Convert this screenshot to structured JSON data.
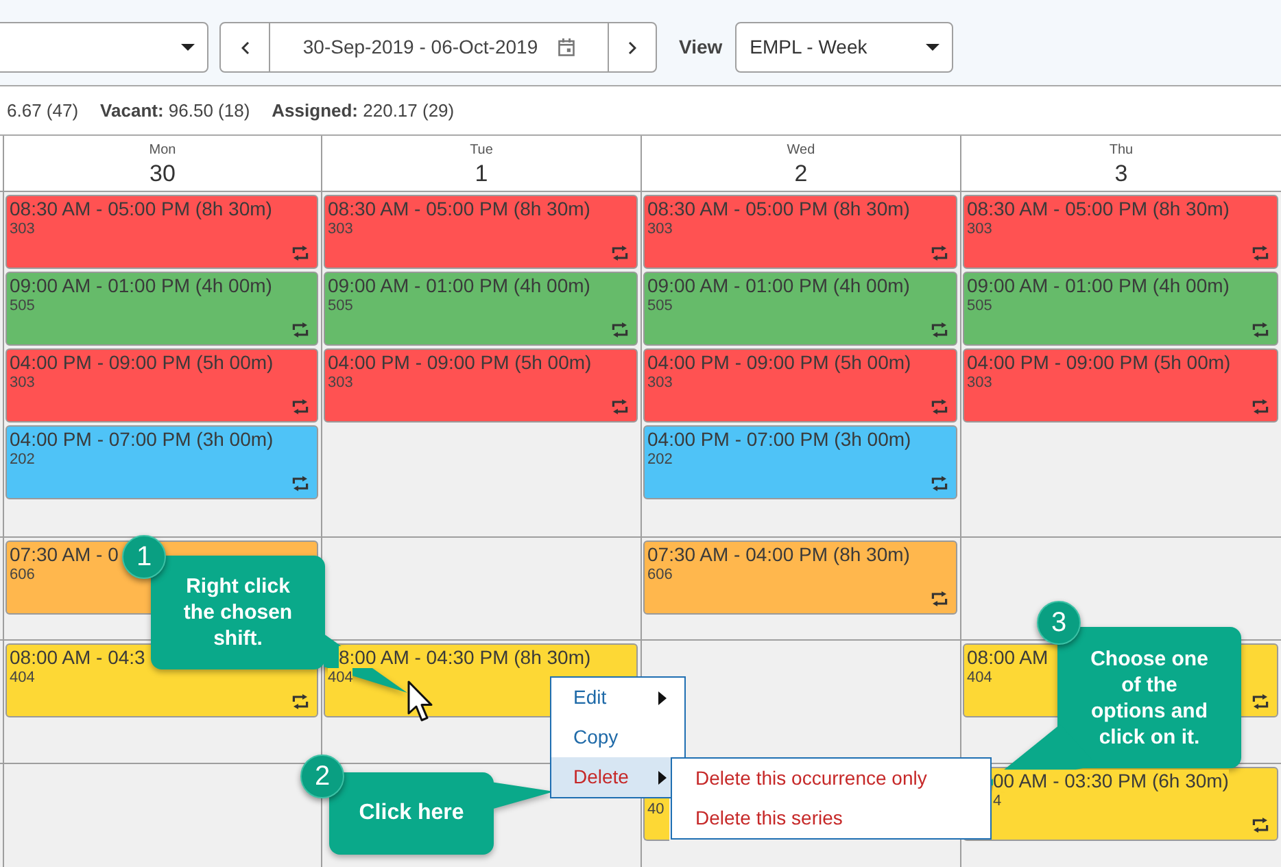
{
  "toolbar": {
    "date_range": "30-Sep-2019 - 06-Oct-2019",
    "view_label": "View",
    "view_value": "EMPL - Week"
  },
  "summary": [
    "6.67 (47)",
    "**Vacant:** 96.50 (18)",
    "**Assigned:** 220.17 (29)"
  ],
  "days": [
    {
      "name": "Mon",
      "date": "30"
    },
    {
      "name": "Tue",
      "date": "1"
    },
    {
      "name": "Wed",
      "date": "2"
    },
    {
      "name": "Thu",
      "date": "3"
    }
  ],
  "rows": [
    {
      "cells": [
        [
          {
            "time": "08:30 AM - 05:00 PM (8h 30m)",
            "room": "303",
            "color": "#ff5252"
          },
          {
            "time": "09:00 AM - 01:00 PM (4h 00m)",
            "room": "505",
            "color": "#66bb6a"
          },
          {
            "time": "04:00 PM - 09:00 PM (5h 00m)",
            "room": "303",
            "color": "#ff5252"
          },
          {
            "time": "04:00 PM - 07:00 PM (3h 00m)",
            "room": "202",
            "color": "#4fc3f7"
          }
        ],
        [
          {
            "time": "08:30 AM - 05:00 PM (8h 30m)",
            "room": "303",
            "color": "#ff5252"
          },
          {
            "time": "09:00 AM - 01:00 PM (4h 00m)",
            "room": "505",
            "color": "#66bb6a"
          },
          {
            "time": "04:00 PM - 09:00 PM (5h 00m)",
            "room": "303",
            "color": "#ff5252"
          }
        ],
        [
          {
            "time": "08:30 AM - 05:00 PM (8h 30m)",
            "room": "303",
            "color": "#ff5252"
          },
          {
            "time": "09:00 AM - 01:00 PM (4h 00m)",
            "room": "505",
            "color": "#66bb6a"
          },
          {
            "time": "04:00 PM - 09:00 PM (5h 00m)",
            "room": "303",
            "color": "#ff5252"
          },
          {
            "time": "04:00 PM - 07:00 PM (3h 00m)",
            "room": "202",
            "color": "#4fc3f7"
          }
        ],
        [
          {
            "time": "08:30 AM - 05:00 PM (8h 30m)",
            "room": "303",
            "color": "#ff5252"
          },
          {
            "time": "09:00 AM - 01:00 PM (4h 00m)",
            "room": "505",
            "color": "#66bb6a"
          },
          {
            "time": "04:00 PM - 09:00 PM (5h 00m)",
            "room": "303",
            "color": "#ff5252"
          }
        ]
      ]
    },
    {
      "cells": [
        [
          {
            "time": "07:30 AM - 0",
            "room": "606",
            "color": "#ffb74d"
          }
        ],
        [],
        [
          {
            "time": "07:30 AM - 04:00 PM (8h 30m)",
            "room": "606",
            "color": "#ffb74d"
          }
        ],
        []
      ]
    },
    {
      "cells": [
        [
          {
            "time": "08:00 AM - 04:3",
            "room": "404",
            "color": "#fdd835"
          }
        ],
        [
          {
            "time": "8:00 AM - 04:30 PM (8h 30m)",
            "room": "404",
            "color": "#fdd835"
          }
        ],
        [],
        [
          {
            "time": "08:00 AM",
            "room": "404",
            "color": "#fdd835"
          }
        ]
      ]
    },
    {
      "cells": [
        [],
        [],
        [
          {
            "room": "40",
            "color": "#fdd835"
          }
        ],
        [
          {
            "time": "00 AM - 03:30 PM (6h 30m)",
            "room": "4",
            "color": "#fdd835"
          }
        ]
      ]
    }
  ],
  "context_menu": [
    {
      "label": "Edit",
      "kind": "normal",
      "submenu": true,
      "selected": false
    },
    {
      "label": "Copy",
      "kind": "normal",
      "submenu": false,
      "selected": false
    },
    {
      "label": "Delete",
      "kind": "danger",
      "submenu": true,
      "selected": true
    }
  ],
  "submenu": [
    "Delete this occurrence only",
    "Delete this series"
  ],
  "callouts": [
    {
      "number": "1",
      "text": "Right click the chosen shift."
    },
    {
      "number": "2",
      "text": "Click here"
    },
    {
      "number": "3",
      "text": "Choose one of the options and click on it."
    }
  ]
}
